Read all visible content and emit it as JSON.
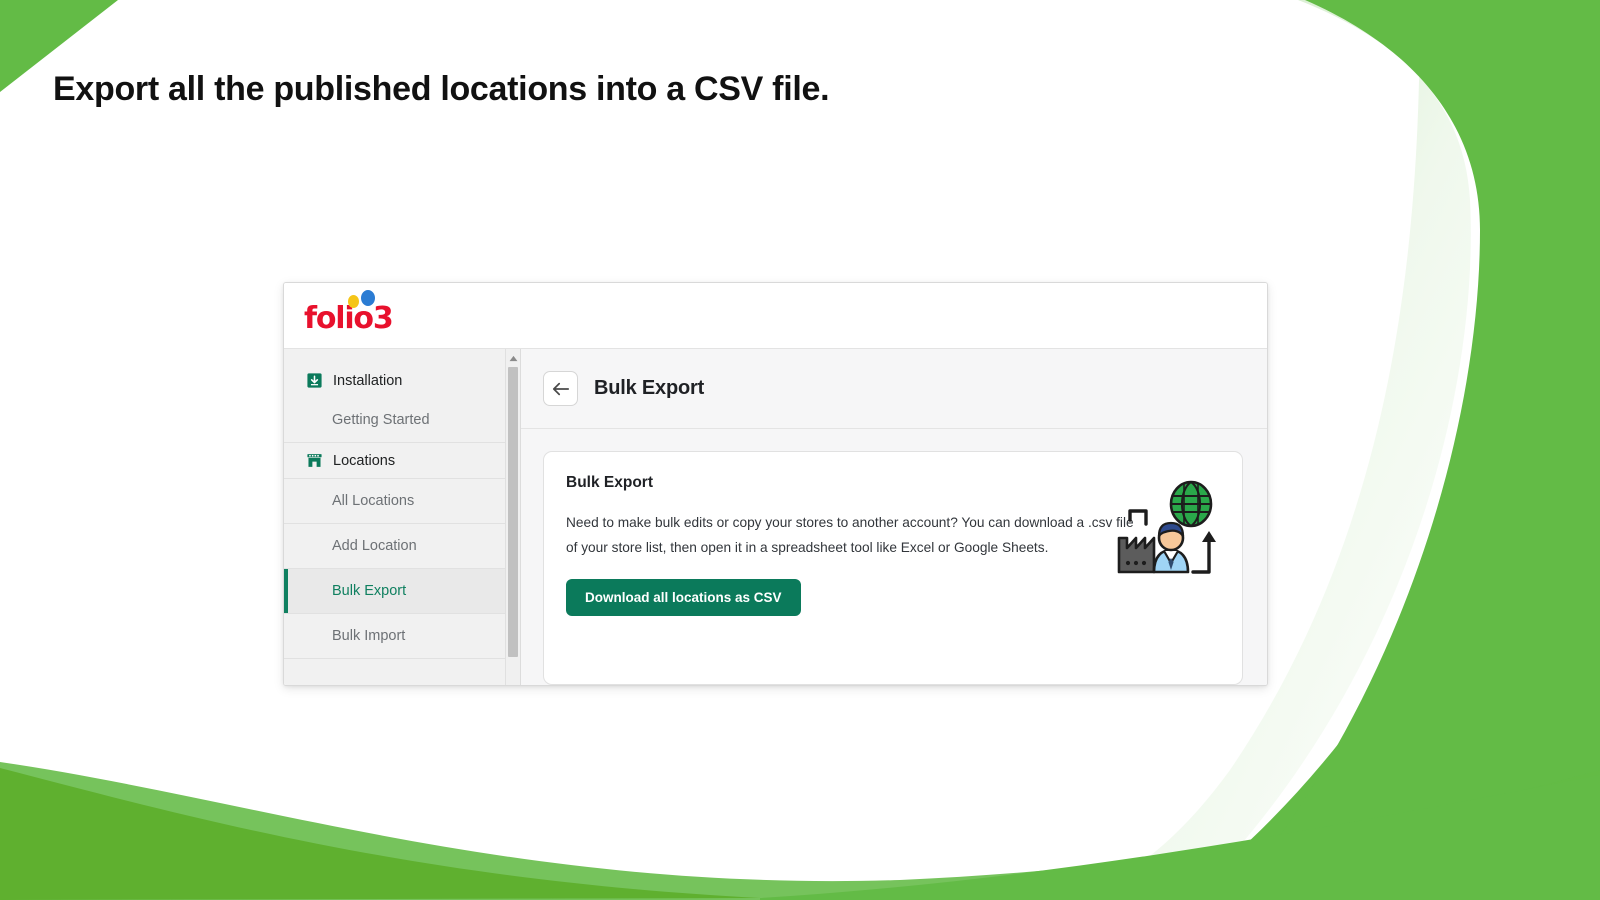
{
  "headline": "Export all the published locations into a CSV file.",
  "theme": {
    "brand_green": "#63BB46",
    "accent_green": "#108060",
    "button_green": "#0b7a5b",
    "logo_red": "#E8112D",
    "logo_dot_yellow": "#F5C518",
    "logo_dot_blue": "#2B7CD3"
  },
  "app": {
    "brand": {
      "logo_text": "folio3",
      "dot_yellow_name": "logo-dot-yellow",
      "dot_blue_name": "logo-dot-blue"
    },
    "sidebar": {
      "sections": [
        {
          "label": "Installation",
          "icon": "install-download-icon",
          "items": [
            {
              "label": "Getting Started",
              "active": false
            }
          ]
        },
        {
          "label": "Locations",
          "icon": "storefront-icon",
          "items": [
            {
              "label": "All Locations",
              "active": false
            },
            {
              "label": "Add Location",
              "active": false
            },
            {
              "label": "Bulk Export",
              "active": true
            },
            {
              "label": "Bulk Import",
              "active": false
            }
          ]
        }
      ],
      "scrollbar": {
        "up_arrow_icon": "scroll-up-arrow-icon",
        "thumb_name": "scrollbar-thumb"
      }
    },
    "header": {
      "back_icon": "back-arrow-icon",
      "title": "Bulk Export"
    },
    "card": {
      "title": "Bulk Export",
      "description": "Need to make bulk edits or copy your stores to another account? You can download a .csv file of your store list, then open it in a spreadsheet tool like Excel or Google Sheets.",
      "button_label": "Download all locations as CSV",
      "illustration_name": "global-export-illustration"
    }
  }
}
